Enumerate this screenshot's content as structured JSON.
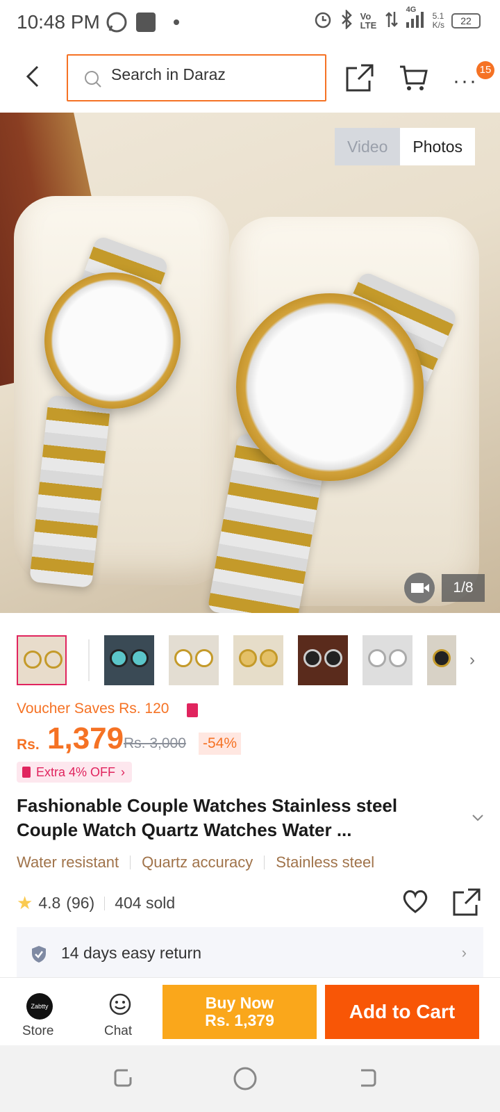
{
  "status_bar": {
    "time": "10:48 PM",
    "net_rate": "5.1",
    "net_unit": "K/s",
    "battery": "22",
    "network": "4G",
    "volte": "Vo LTE"
  },
  "search": {
    "placeholder": "Search in Daraz"
  },
  "cart_badge": "15",
  "gallery": {
    "tab_video": "Video",
    "tab_photos": "Photos",
    "counter": "1/8",
    "thumb_count": 7
  },
  "voucher": {
    "text": "Voucher Saves Rs. 120"
  },
  "price": {
    "currency": "Rs.",
    "current": "1,379",
    "original": "Rs. 3,000",
    "discount": "-54%",
    "extra_off": "Extra 4% OFF"
  },
  "product": {
    "title": "Fashionable Couple Watches Stainless steel Couple Watch Quartz Watches Water ...",
    "highlights": [
      "Water resistant",
      "Quartz accuracy",
      "Stainless steel"
    ],
    "rating": "4.8",
    "reviews": "(96)",
    "sold": "404 sold"
  },
  "returns": {
    "text": "14 days easy return"
  },
  "action_bar": {
    "store_label": "Store",
    "store_logo_text": "Zabtty",
    "chat_label": "Chat",
    "buy_now_label": "Buy Now",
    "buy_now_price": "Rs. 1,379",
    "add_to_cart_label": "Add to Cart"
  },
  "colors": {
    "accent": "#f57224",
    "buy_now": "#faa71b",
    "add_to_cart": "#f85606",
    "pink": "#e0245e"
  }
}
